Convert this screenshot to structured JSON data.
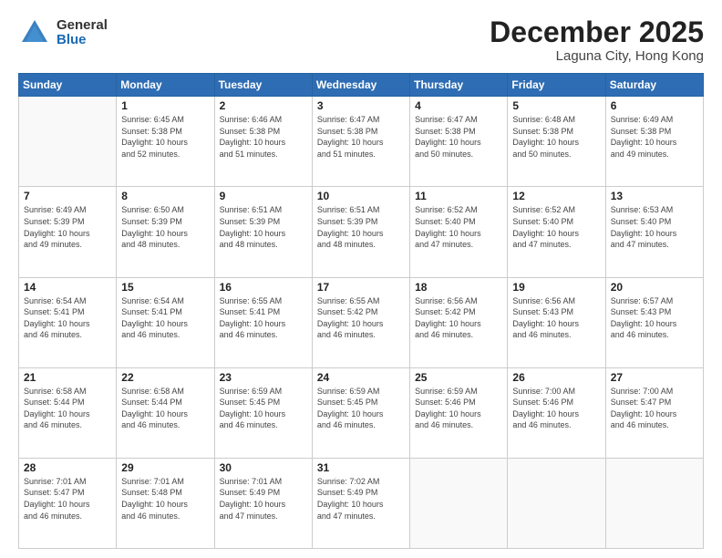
{
  "header": {
    "logo_general": "General",
    "logo_blue": "Blue",
    "month": "December 2025",
    "location": "Laguna City, Hong Kong"
  },
  "weekdays": [
    "Sunday",
    "Monday",
    "Tuesday",
    "Wednesday",
    "Thursday",
    "Friday",
    "Saturday"
  ],
  "weeks": [
    [
      {
        "day": "",
        "info": ""
      },
      {
        "day": "1",
        "info": "Sunrise: 6:45 AM\nSunset: 5:38 PM\nDaylight: 10 hours\nand 52 minutes."
      },
      {
        "day": "2",
        "info": "Sunrise: 6:46 AM\nSunset: 5:38 PM\nDaylight: 10 hours\nand 51 minutes."
      },
      {
        "day": "3",
        "info": "Sunrise: 6:47 AM\nSunset: 5:38 PM\nDaylight: 10 hours\nand 51 minutes."
      },
      {
        "day": "4",
        "info": "Sunrise: 6:47 AM\nSunset: 5:38 PM\nDaylight: 10 hours\nand 50 minutes."
      },
      {
        "day": "5",
        "info": "Sunrise: 6:48 AM\nSunset: 5:38 PM\nDaylight: 10 hours\nand 50 minutes."
      },
      {
        "day": "6",
        "info": "Sunrise: 6:49 AM\nSunset: 5:38 PM\nDaylight: 10 hours\nand 49 minutes."
      }
    ],
    [
      {
        "day": "7",
        "info": "Sunrise: 6:49 AM\nSunset: 5:39 PM\nDaylight: 10 hours\nand 49 minutes."
      },
      {
        "day": "8",
        "info": "Sunrise: 6:50 AM\nSunset: 5:39 PM\nDaylight: 10 hours\nand 48 minutes."
      },
      {
        "day": "9",
        "info": "Sunrise: 6:51 AM\nSunset: 5:39 PM\nDaylight: 10 hours\nand 48 minutes."
      },
      {
        "day": "10",
        "info": "Sunrise: 6:51 AM\nSunset: 5:39 PM\nDaylight: 10 hours\nand 48 minutes."
      },
      {
        "day": "11",
        "info": "Sunrise: 6:52 AM\nSunset: 5:40 PM\nDaylight: 10 hours\nand 47 minutes."
      },
      {
        "day": "12",
        "info": "Sunrise: 6:52 AM\nSunset: 5:40 PM\nDaylight: 10 hours\nand 47 minutes."
      },
      {
        "day": "13",
        "info": "Sunrise: 6:53 AM\nSunset: 5:40 PM\nDaylight: 10 hours\nand 47 minutes."
      }
    ],
    [
      {
        "day": "14",
        "info": "Sunrise: 6:54 AM\nSunset: 5:41 PM\nDaylight: 10 hours\nand 46 minutes."
      },
      {
        "day": "15",
        "info": "Sunrise: 6:54 AM\nSunset: 5:41 PM\nDaylight: 10 hours\nand 46 minutes."
      },
      {
        "day": "16",
        "info": "Sunrise: 6:55 AM\nSunset: 5:41 PM\nDaylight: 10 hours\nand 46 minutes."
      },
      {
        "day": "17",
        "info": "Sunrise: 6:55 AM\nSunset: 5:42 PM\nDaylight: 10 hours\nand 46 minutes."
      },
      {
        "day": "18",
        "info": "Sunrise: 6:56 AM\nSunset: 5:42 PM\nDaylight: 10 hours\nand 46 minutes."
      },
      {
        "day": "19",
        "info": "Sunrise: 6:56 AM\nSunset: 5:43 PM\nDaylight: 10 hours\nand 46 minutes."
      },
      {
        "day": "20",
        "info": "Sunrise: 6:57 AM\nSunset: 5:43 PM\nDaylight: 10 hours\nand 46 minutes."
      }
    ],
    [
      {
        "day": "21",
        "info": "Sunrise: 6:58 AM\nSunset: 5:44 PM\nDaylight: 10 hours\nand 46 minutes."
      },
      {
        "day": "22",
        "info": "Sunrise: 6:58 AM\nSunset: 5:44 PM\nDaylight: 10 hours\nand 46 minutes."
      },
      {
        "day": "23",
        "info": "Sunrise: 6:59 AM\nSunset: 5:45 PM\nDaylight: 10 hours\nand 46 minutes."
      },
      {
        "day": "24",
        "info": "Sunrise: 6:59 AM\nSunset: 5:45 PM\nDaylight: 10 hours\nand 46 minutes."
      },
      {
        "day": "25",
        "info": "Sunrise: 6:59 AM\nSunset: 5:46 PM\nDaylight: 10 hours\nand 46 minutes."
      },
      {
        "day": "26",
        "info": "Sunrise: 7:00 AM\nSunset: 5:46 PM\nDaylight: 10 hours\nand 46 minutes."
      },
      {
        "day": "27",
        "info": "Sunrise: 7:00 AM\nSunset: 5:47 PM\nDaylight: 10 hours\nand 46 minutes."
      }
    ],
    [
      {
        "day": "28",
        "info": "Sunrise: 7:01 AM\nSunset: 5:47 PM\nDaylight: 10 hours\nand 46 minutes."
      },
      {
        "day": "29",
        "info": "Sunrise: 7:01 AM\nSunset: 5:48 PM\nDaylight: 10 hours\nand 46 minutes."
      },
      {
        "day": "30",
        "info": "Sunrise: 7:01 AM\nSunset: 5:49 PM\nDaylight: 10 hours\nand 47 minutes."
      },
      {
        "day": "31",
        "info": "Sunrise: 7:02 AM\nSunset: 5:49 PM\nDaylight: 10 hours\nand 47 minutes."
      },
      {
        "day": "",
        "info": ""
      },
      {
        "day": "",
        "info": ""
      },
      {
        "day": "",
        "info": ""
      }
    ]
  ]
}
